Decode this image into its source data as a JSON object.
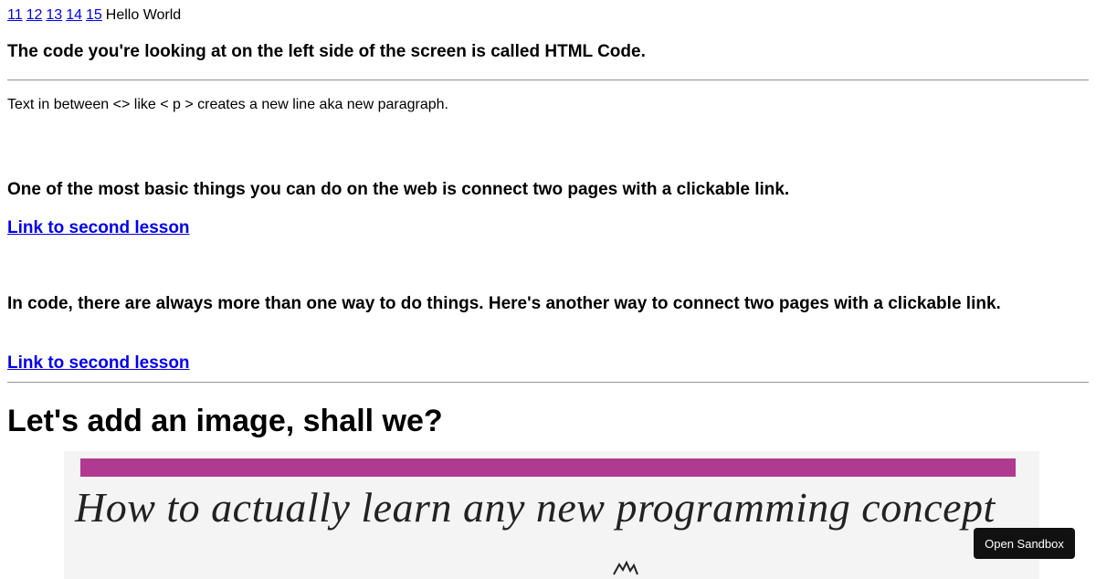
{
  "top_links": [
    "11",
    "12",
    "13",
    "14",
    "15"
  ],
  "hello_text": "Hello World",
  "heading_code": "The code you're looking at on the left side of the screen is called HTML Code.",
  "paragraph_text": "Text in between <> like < p > creates a new line aka new paragraph.",
  "heading_basic": "One of the most basic things you can do on the web is connect two pages with a clickable link.",
  "link1_label": "Link to second lesson",
  "heading_another": "In code, there are always more than one way to do things. Here's another way to connect two pages with a clickable link.",
  "link2_label": "Link to second lesson",
  "image_heading": "Let's add an image, shall we?",
  "image_caption_text": "How to actually learn any new programming concept",
  "sandbox_label": "Open Sandbox",
  "colors": {
    "link": "#0000ee",
    "image_band": "#b03a8f",
    "sandbox_bg": "#111111"
  }
}
